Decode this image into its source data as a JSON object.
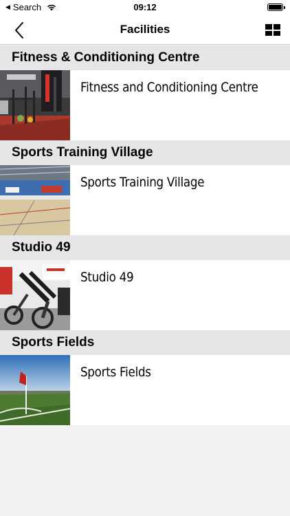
{
  "status_bar": {
    "back_app": "Search",
    "time": "09:12"
  },
  "nav": {
    "title": "Facilities"
  },
  "sections": [
    {
      "header": "Fitness & Conditioning Centre",
      "item": "Fitness and Conditioning Centre",
      "image": "gym-interior"
    },
    {
      "header": "Sports Training Village",
      "item": "Sports Training Village",
      "image": "sports-hall"
    },
    {
      "header": "Studio 49",
      "item": "Studio 49",
      "image": "spin-bikes"
    },
    {
      "header": "Sports Fields",
      "item": "Sports Fields",
      "image": "football-pitch"
    }
  ],
  "colors": {
    "section_header_bg": "#e6e6e9",
    "row_bg": "#ffffff",
    "page_bg": "#f2f2f2"
  }
}
